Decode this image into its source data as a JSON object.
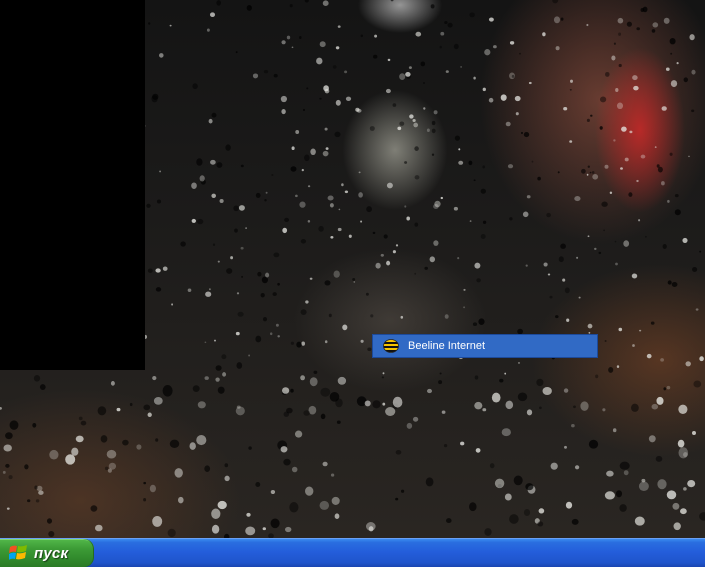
{
  "desktop": {
    "context_menu": {
      "item_label": "Beeline Internet",
      "item_icon": "beeline-bee-icon",
      "highlight_color": "#316ac5"
    }
  },
  "taskbar": {
    "start_label": "пуск",
    "start_icon": "windows-xp-logo-icon",
    "color": "#245edb",
    "start_color": "#3c9b36"
  }
}
